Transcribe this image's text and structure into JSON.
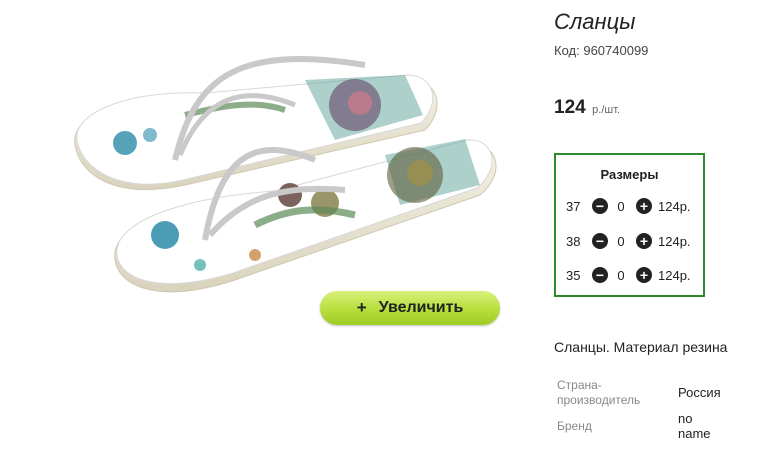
{
  "product": {
    "title": "Сланцы",
    "code_label": "Код:",
    "code_value": "960740099",
    "price": "124",
    "price_unit": "р./шт."
  },
  "zoom_button": {
    "icon": "+",
    "label": "Увеличить"
  },
  "sizes": {
    "title": "Размеры",
    "rows": [
      {
        "size": "37",
        "qty": "0",
        "price": "124р."
      },
      {
        "size": "38",
        "qty": "0",
        "price": "124р."
      },
      {
        "size": "35",
        "qty": "0",
        "price": "124р."
      }
    ],
    "minus_glyph": "−",
    "plus_glyph": "+"
  },
  "description": "Сланцы. Материал резина",
  "attributes": [
    {
      "label": "Страна-\nпроизводитель",
      "value": "Россия"
    },
    {
      "label": "Бренд",
      "value": "no\nname"
    }
  ],
  "colors": {
    "accent": "#2d8a2d",
    "button_green": "#b6de3c"
  }
}
